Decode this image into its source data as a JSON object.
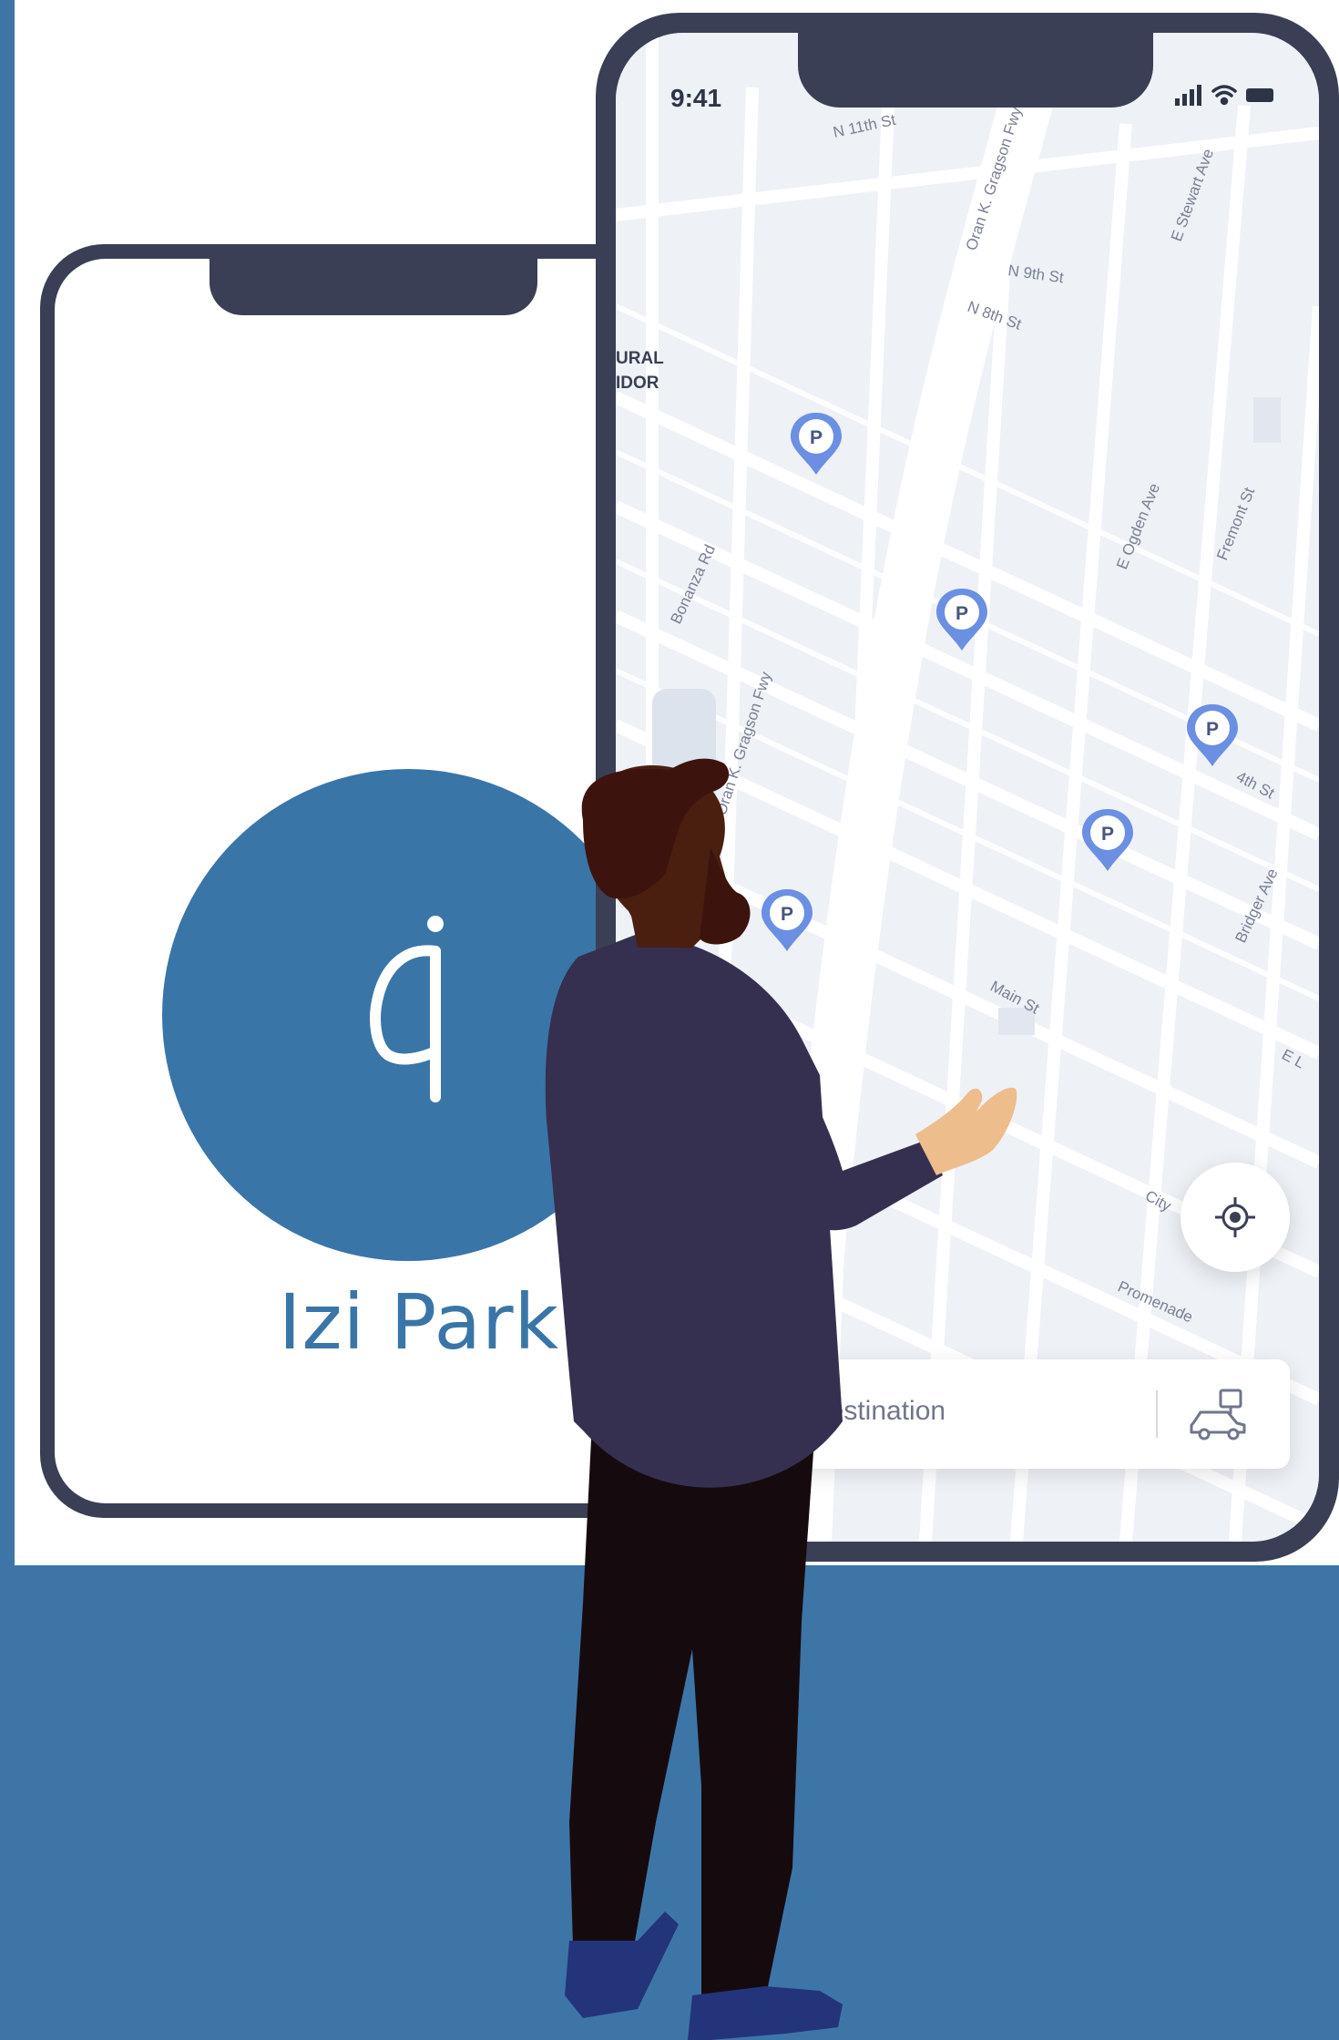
{
  "splash": {
    "app_name": "Izi Park",
    "logo_icon": "izi-park-logo-icon"
  },
  "map_screen": {
    "status_time": "9:41",
    "status_icons": [
      "signal-icon",
      "wifi-icon",
      "battery-icon"
    ],
    "map_labels": {
      "n11": "N 11th St",
      "oran": "Oran K. Gragson Fwy",
      "stewart": "E Stewart Ave",
      "n9": "N 9th St",
      "n8": "N 8th St",
      "corridor_1": "URAL",
      "corridor_2": "IDOR",
      "bonanza": "Bonanza Rd",
      "ogden": "E Ogden Ave",
      "fremont": "Fremont St",
      "gragson": "Oran K. Gragson Fwy",
      "fourth": "4th St",
      "bridger": "Bridger Ave",
      "main": "Main St",
      "city": "City",
      "promenade": "Promenade",
      "lewis": "E L"
    },
    "parking_pins": [
      "P",
      "P",
      "P",
      "P",
      "P"
    ],
    "locate_icon": "crosshair-icon",
    "destination_placeholder": "Destination",
    "vehicle_icon": "car-icon"
  },
  "colors": {
    "brand_blue": "#3a75a8",
    "background_blue": "#3e75a7",
    "phone_frame": "#3a3f55",
    "pin_blue": "#6b8fe3"
  }
}
